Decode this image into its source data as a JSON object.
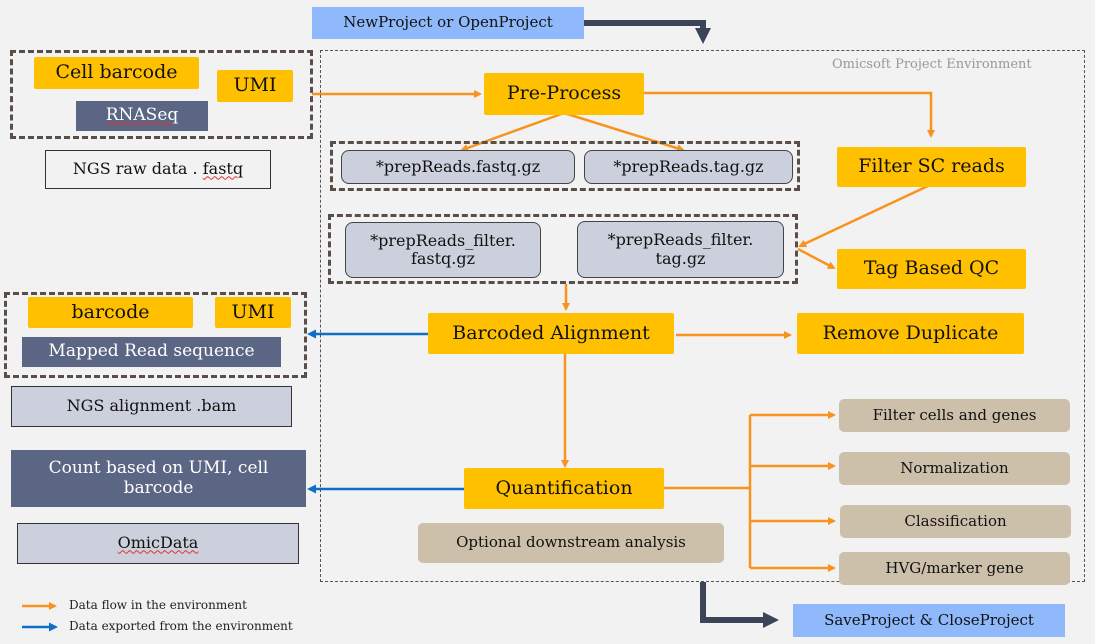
{
  "project_actions": {
    "open": "NewProject or OpenProject",
    "close": "SaveProject & CloseProject"
  },
  "environment": {
    "label": "Omicsoft Project Environment"
  },
  "input": {
    "cell_barcode": "Cell barcode",
    "umi": "UMI",
    "rnaseq": "RNASeq",
    "raw_data": "NGS raw data . fastq"
  },
  "steps": {
    "preprocess": "Pre-Process",
    "filter_sc_reads": "Filter SC reads",
    "tag_based_qc": "Tag Based QC",
    "barcoded_alignment": "Barcoded Alignment",
    "remove_duplicate": "Remove Duplicate",
    "quantification": "Quantification"
  },
  "files": {
    "prep_fastq": "*prepReads.fastq.gz",
    "prep_tag": "*prepReads.tag.gz",
    "filter_fastq_line1": "*prepReads_filter.",
    "filter_fastq_line2": "fastq.gz",
    "filter_tag_line1": "*prepReads_filter.",
    "filter_tag_line2": "tag.gz"
  },
  "alignment_output": {
    "barcode": "barcode",
    "umi": "UMI",
    "mapped_read": "Mapped Read sequence",
    "bam": "NGS alignment .bam"
  },
  "count_output": {
    "count": "Count based on UMI, cell barcode",
    "omicdata": "OmicData"
  },
  "downstream": {
    "label": "Optional downstream analysis",
    "items": [
      "Filter cells and genes",
      "Normalization",
      "Classification",
      "HVG/marker gene"
    ]
  },
  "legend": {
    "orange": "Data flow in the environment",
    "blue": "Data exported from the environment"
  },
  "colors": {
    "flow": "#f7931e",
    "export": "#0f6fc6",
    "project": "#3c4458",
    "step": "#ffc000"
  }
}
